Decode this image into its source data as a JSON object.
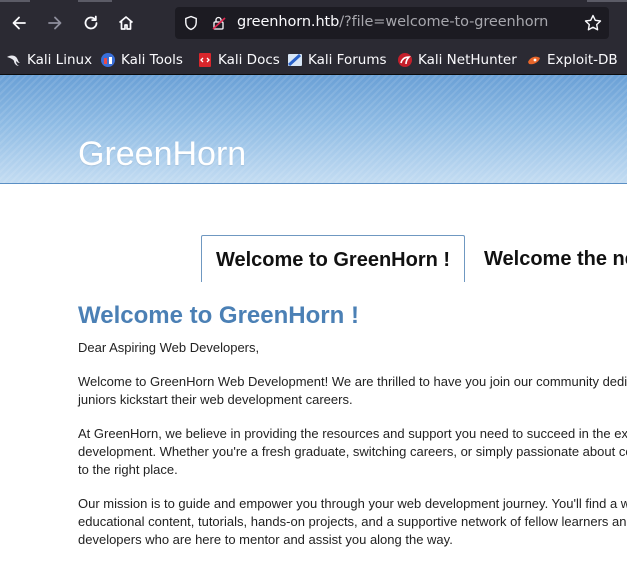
{
  "browser": {
    "url_host": "greenhorn.htb",
    "url_rest": "/?file=welcome-to-greenhorn"
  },
  "bookmarks": [
    {
      "label": "Kali Linux",
      "icon": "kali-dragon-icon"
    },
    {
      "label": "Kali Tools",
      "icon": "kali-tools-icon"
    },
    {
      "label": "Kali Docs",
      "icon": "kali-docs-icon"
    },
    {
      "label": "Kali Forums",
      "icon": "kali-forums-icon"
    },
    {
      "label": "Kali NetHunter",
      "icon": "kali-nethunter-icon"
    },
    {
      "label": "Exploit-DB",
      "icon": "exploit-db-icon"
    }
  ],
  "site": {
    "title": "GreenHorn",
    "banner_color": "#7fb0df"
  },
  "tabs": [
    {
      "label": "Welcome to GreenHorn !",
      "active": true
    },
    {
      "label": "Welcome the new",
      "active": false
    }
  ],
  "article": {
    "heading": "Welcome to GreenHorn !",
    "greeting": "Dear Aspiring Web Developers,",
    "p1": [
      "Welcome to GreenHorn Web Development! We are thrilled to have you join our community dedi",
      "juniors kickstart their web development careers."
    ],
    "p2": [
      "At GreenHorn, we believe in providing the resources and support you need to succeed in the ex",
      "development. Whether you're a fresh graduate, switching careers, or simply passionate about co",
      "to the right place."
    ],
    "p3": [
      "Our mission is to guide and empower you through your web development journey. You'll find a w",
      "educational content, tutorials, hands-on projects, and a supportive network of fellow learners an",
      "developers who are here to mentor and assist you along the way."
    ]
  }
}
